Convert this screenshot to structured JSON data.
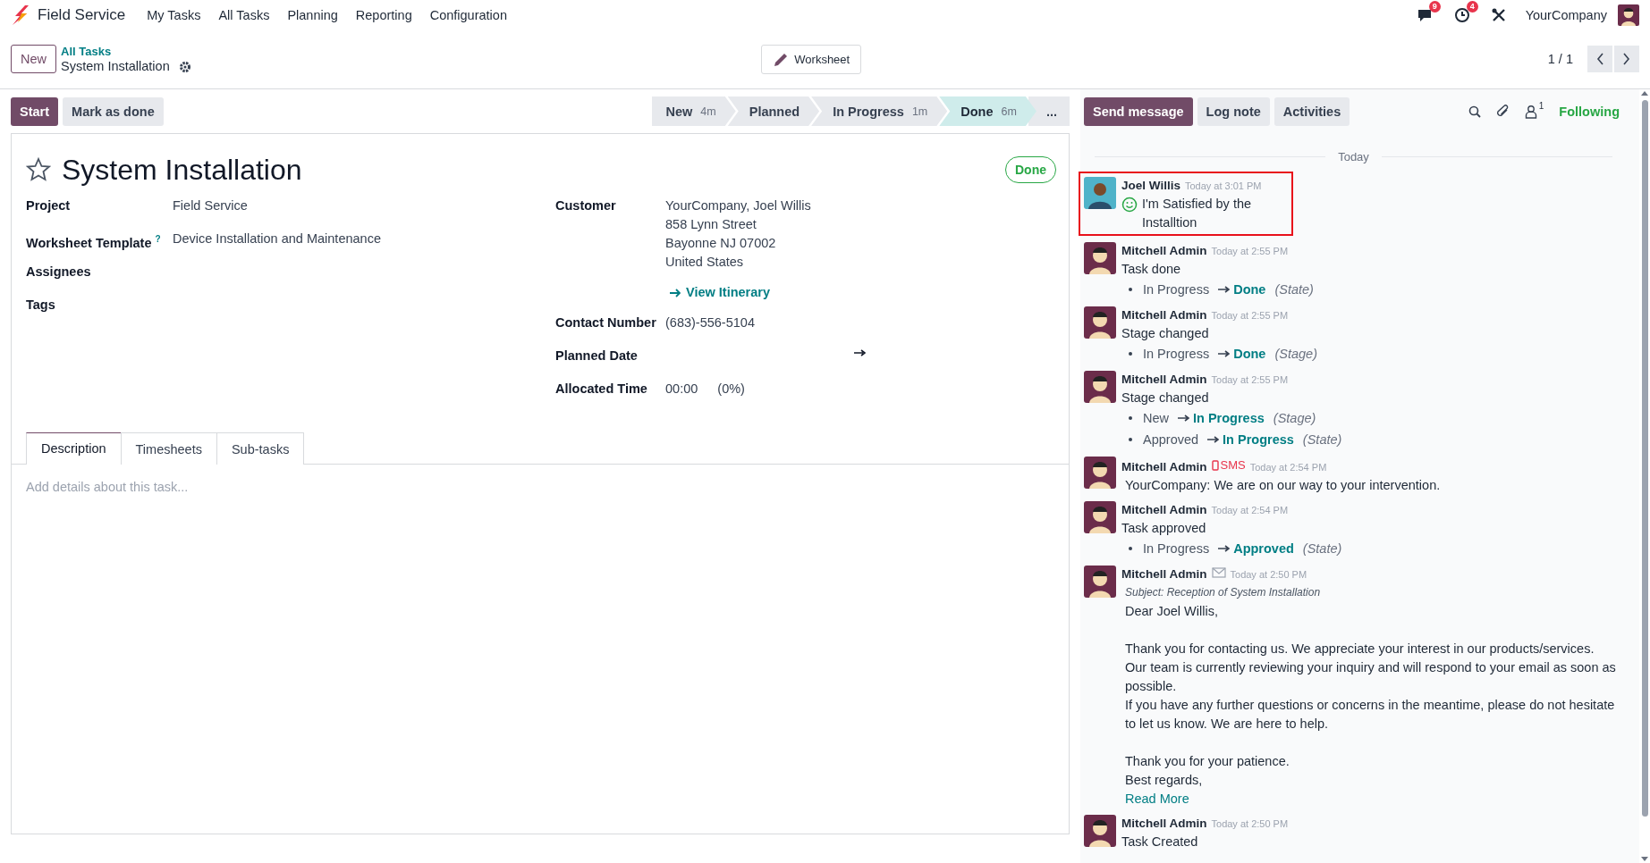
{
  "navbar": {
    "app_name": "Field Service",
    "menu": [
      "My Tasks",
      "All Tasks",
      "Planning",
      "Reporting",
      "Configuration"
    ],
    "messages_badge": "9",
    "activities_badge": "4",
    "company": "YourCompany"
  },
  "control_panel": {
    "new_button": "New",
    "breadcrumb_parent": "All Tasks",
    "record_name": "System Installation",
    "worksheet_button": "Worksheet",
    "pager": "1 / 1"
  },
  "actions": [
    {
      "label": "Start",
      "primary": true
    },
    {
      "label": "Mark as done",
      "primary": false
    }
  ],
  "stages": [
    {
      "label": "New",
      "duration": "4m",
      "selected": false
    },
    {
      "label": "Planned",
      "selected": false
    },
    {
      "label": "In Progress",
      "duration": "1m",
      "selected": false
    },
    {
      "label": "Done",
      "duration": "6m",
      "selected": true
    }
  ],
  "stages_more": "...",
  "form": {
    "starred": false,
    "title": "System Installation",
    "state_badge": "Done",
    "left_fields": [
      {
        "label": "Project",
        "value": "Field Service"
      },
      {
        "label": "Worksheet Template",
        "help": "?",
        "value": "Device Installation and Maintenance"
      },
      {
        "label": "Assignees"
      },
      {
        "label": "Tags"
      }
    ],
    "right_fields": [
      {
        "kind": "address",
        "label": "Customer",
        "lines": [
          "YourCompany, Joel Willis",
          "858 Lynn Street",
          "Bayonne NJ 07002",
          "United States"
        ],
        "link": "View Itinerary"
      },
      {
        "kind": "text",
        "label": "Contact Number",
        "value": "(683)-556-5104"
      },
      {
        "kind": "daterange",
        "label": "Planned Date"
      },
      {
        "kind": "duration",
        "label": "Allocated Time",
        "value": "00:00",
        "percent": "(0%)"
      }
    ],
    "tabs": [
      {
        "label": "Description",
        "selected": true
      },
      {
        "label": "Timesheets",
        "selected": false
      },
      {
        "label": "Sub-tasks",
        "selected": false
      }
    ],
    "description_placeholder": "Add details about this task..."
  },
  "chatter": {
    "buttons": [
      {
        "label": "Send message",
        "primary": true
      },
      {
        "label": "Log note",
        "primary": false
      },
      {
        "label": "Activities",
        "primary": false
      }
    ],
    "followers_count": "1",
    "follow_label": "Following",
    "date_separator": "Today",
    "messages": [
      {
        "kind": "rating",
        "avatar": {
          "kind": "customer"
        },
        "author": "Joel Willis",
        "time": "Today at 3:01 PM",
        "highlighted": true,
        "body": "I'm Satisfied by the Installtion"
      },
      {
        "kind": "tracking",
        "avatar": {
          "kind": "user"
        },
        "author": "Mitchell Admin",
        "time": "Today at 2:55 PM",
        "highlighted": false,
        "body": "Task done",
        "tracking": [
          {
            "old": "In Progress",
            "new": "Done",
            "field": "(State)"
          }
        ]
      },
      {
        "kind": "tracking",
        "avatar": {
          "kind": "user"
        },
        "author": "Mitchell Admin",
        "time": "Today at 2:55 PM",
        "highlighted": false,
        "body": "Stage changed",
        "tracking": [
          {
            "old": "In Progress",
            "new": "Done",
            "field": "(Stage)"
          }
        ]
      },
      {
        "kind": "tracking",
        "avatar": {
          "kind": "user"
        },
        "author": "Mitchell Admin",
        "time": "Today at 2:55 PM",
        "highlighted": false,
        "body": "Stage changed",
        "tracking": [
          {
            "old": "New",
            "new": "In Progress",
            "field": "(Stage)"
          },
          {
            "old": "Approved",
            "new": "In Progress",
            "field": "(State)"
          }
        ]
      },
      {
        "kind": "sms",
        "avatar": {
          "kind": "user"
        },
        "author": "Mitchell Admin",
        "channel": "SMS",
        "time": "Today at 2:54 PM",
        "highlighted": false,
        "body": "YourCompany: We are on our way to your intervention."
      },
      {
        "kind": "tracking",
        "avatar": {
          "kind": "user"
        },
        "author": "Mitchell Admin",
        "time": "Today at 2:54 PM",
        "highlighted": false,
        "body": "Task approved",
        "tracking": [
          {
            "old": "In Progress",
            "new": "Approved",
            "field": "(State)"
          }
        ]
      },
      {
        "kind": "email",
        "avatar": {
          "kind": "user"
        },
        "author": "Mitchell Admin",
        "time": "Today at 2:50 PM",
        "highlighted": false,
        "subject": "Subject: Reception of System Installation",
        "paragraphs": [
          [
            "Dear Joel Willis,"
          ],
          [
            "Thank you for contacting us. We appreciate your interest in our products/services.",
            "Our team is currently reviewing your inquiry and will respond to your email as soon as possible.",
            "If you have any further questions or concerns in the meantime, please do not hesitate to let us know. We are here to help."
          ],
          [
            "Thank you for your patience.",
            "Best regards,"
          ]
        ],
        "link": "Read More"
      },
      {
        "kind": "note",
        "avatar": {
          "kind": "user"
        },
        "author": "Mitchell Admin",
        "time": "Today at 2:50 PM",
        "highlighted": false,
        "body": "Task Created"
      }
    ]
  }
}
